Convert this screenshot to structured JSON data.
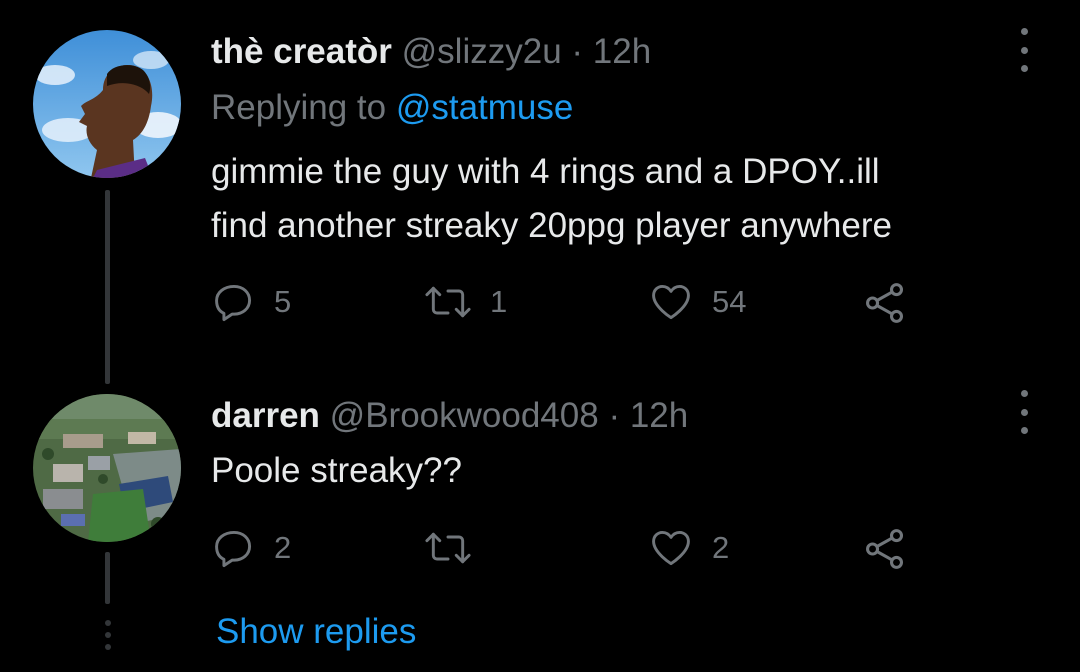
{
  "tweets": [
    {
      "name": "thè creatòr",
      "handle": "@slizzy2u",
      "separator": "·",
      "time": "12h",
      "replying_prefix": "Replying to ",
      "replying_to": "@statmuse",
      "text_lines": [
        "gimmie the guy with 4 rings and a DPOY..ill",
        "find another streaky 20ppg player anywhere"
      ],
      "reply_count": "5",
      "retweet_count": "1",
      "like_count": "54"
    },
    {
      "name": "darren",
      "handle": "@Brookwood408",
      "separator": "·",
      "time": "12h",
      "text_lines": [
        "Poole streaky??"
      ],
      "reply_count": "2",
      "retweet_count": "",
      "like_count": "2"
    }
  ],
  "show_replies": "Show replies",
  "icons": {
    "reply": "reply-icon",
    "retweet": "retweet-icon",
    "like": "heart-icon",
    "share": "share-icon",
    "more": "more-icon"
  },
  "colors": {
    "background": "#000000",
    "text": "#e7e9ea",
    "muted": "#71767b",
    "link": "#1d9bf0",
    "line": "#333639"
  }
}
